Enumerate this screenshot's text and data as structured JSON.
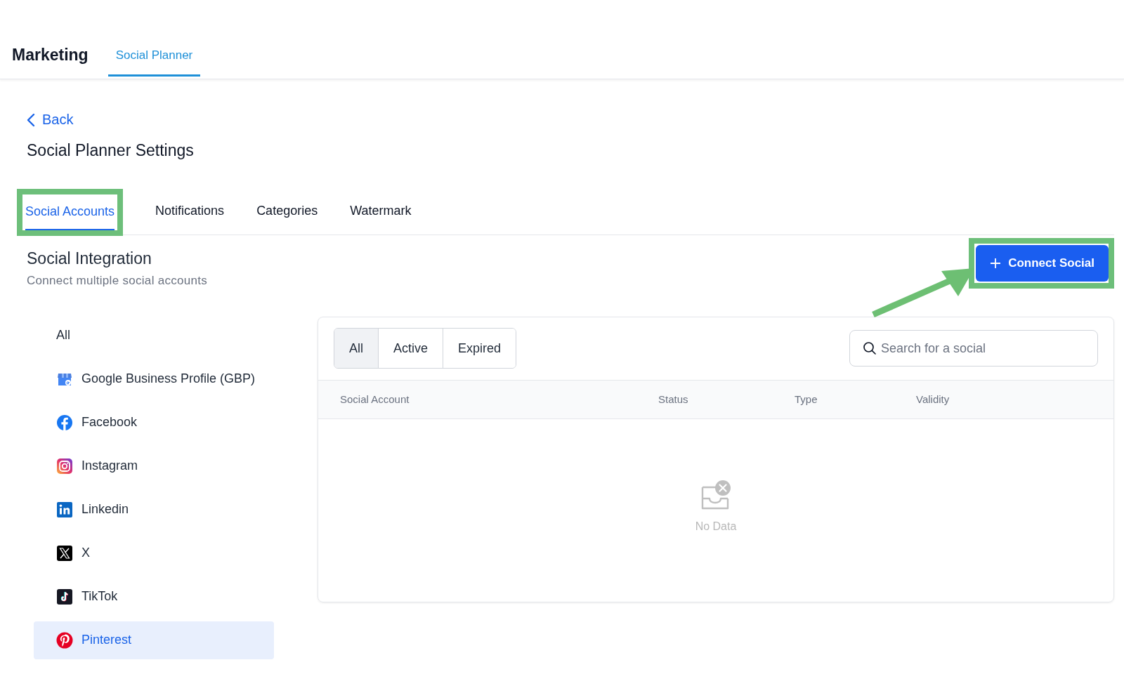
{
  "header": {
    "title": "Marketing",
    "tabs": [
      {
        "label": "Social Planner",
        "selected": true
      }
    ]
  },
  "back_link": "Back",
  "page_title": "Social Planner Settings",
  "settings_tabs": [
    {
      "label": "Social Accounts",
      "selected": true,
      "highlighted": true
    },
    {
      "label": "Notifications",
      "selected": false,
      "highlighted": false
    },
    {
      "label": "Categories",
      "selected": false,
      "highlighted": false
    },
    {
      "label": "Watermark",
      "selected": false,
      "highlighted": false
    }
  ],
  "section": {
    "title": "Social Integration",
    "subtitle": "Connect multiple social accounts"
  },
  "connect_button": {
    "label": "Connect Social",
    "highlighted": true
  },
  "platforms": [
    {
      "label": "All",
      "kind": "all",
      "selected": false
    },
    {
      "label": "Google Business Profile (GBP)",
      "kind": "gbp",
      "selected": false
    },
    {
      "label": "Facebook",
      "kind": "facebook",
      "selected": false
    },
    {
      "label": "Instagram",
      "kind": "instagram",
      "selected": false
    },
    {
      "label": "Linkedin",
      "kind": "linkedin",
      "selected": false
    },
    {
      "label": "X",
      "kind": "x",
      "selected": false
    },
    {
      "label": "TikTok",
      "kind": "tiktok",
      "selected": false
    },
    {
      "label": "Pinterest",
      "kind": "pinterest",
      "selected": true
    }
  ],
  "filter_tabs": [
    {
      "label": "All",
      "selected": true
    },
    {
      "label": "Active",
      "selected": false
    },
    {
      "label": "Expired",
      "selected": false
    }
  ],
  "search": {
    "placeholder": "Search for a social"
  },
  "table": {
    "columns": [
      "Social Account",
      "Status",
      "Type",
      "Validity"
    ],
    "empty_text": "No Data"
  }
}
